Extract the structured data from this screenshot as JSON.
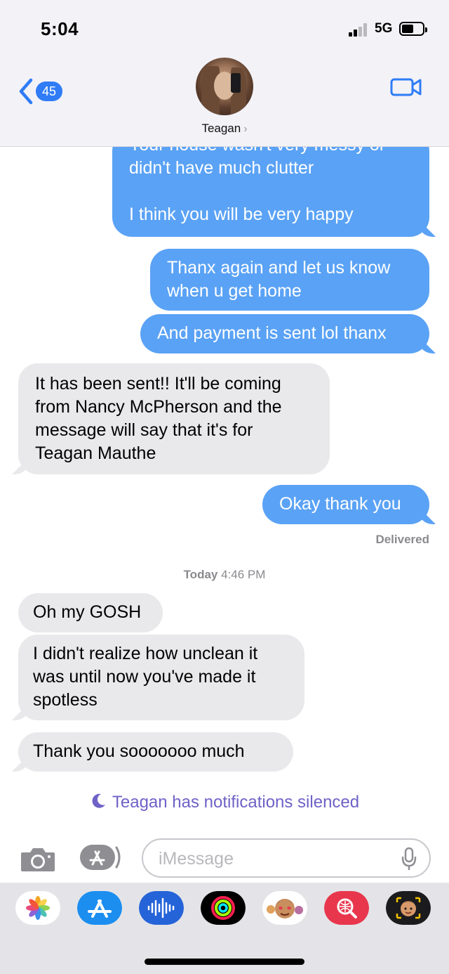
{
  "status_bar": {
    "time": "5:04",
    "network": "5G"
  },
  "header": {
    "back_count": "45",
    "contact_name": "Teagan",
    "contact_chevron": "›"
  },
  "messages": [
    {
      "from": "me",
      "lines": [
        "Your house wasn't very messy or",
        "didn't have much clutter",
        "",
        "I think you will be very happy"
      ]
    },
    {
      "from": "me",
      "lines": [
        "Thanx again and let us know",
        "when u get home"
      ]
    },
    {
      "from": "me",
      "lines": [
        "And payment is sent lol thanx"
      ]
    },
    {
      "from": "them",
      "lines": [
        "It has been sent!! It'll be coming",
        "from Nancy McPherson and the",
        "message will say that it's for",
        "Teagan Mauthe"
      ]
    },
    {
      "from": "me",
      "lines": [
        "Okay thank you"
      ]
    },
    {
      "from": "them",
      "lines": [
        "Oh my GOSH"
      ]
    },
    {
      "from": "them",
      "lines": [
        "I didn't realize how unclean it",
        "was until now you've made it",
        "spotless"
      ]
    },
    {
      "from": "them",
      "lines": [
        "Thank you sooooooo much"
      ]
    }
  ],
  "delivered_label": "Delivered",
  "timestamp": {
    "day": "Today",
    "time": "4:46 PM"
  },
  "silenced_notice": "Teagan has notifications silenced",
  "compose": {
    "placeholder": "iMessage"
  },
  "app_drawer": [
    "photos-app",
    "app-store",
    "audio-message",
    "activity-app",
    "memoji-stickers",
    "web-search-images",
    "memoji-app"
  ],
  "colors": {
    "sent_bubble": "#5aa2f5",
    "received_bubble": "#e9e9eb",
    "accent": "#2f7cf6",
    "silenced": "#6e62c7"
  }
}
